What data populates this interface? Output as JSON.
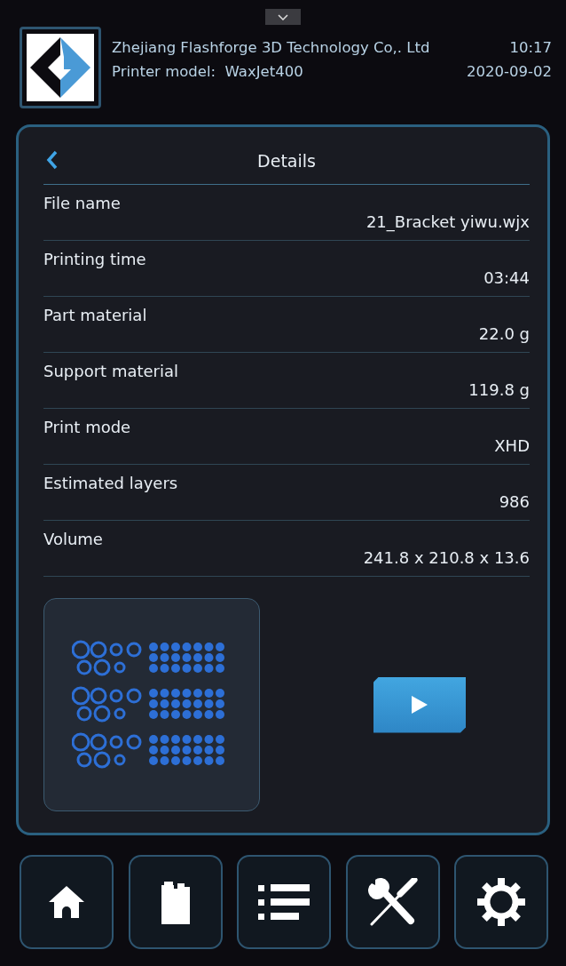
{
  "header": {
    "company": "Zhejiang Flashforge 3D Technology Co,. Ltd",
    "time": "10:17",
    "model_label": "Printer model:",
    "model": "WaxJet400",
    "date": "2020-09-02"
  },
  "details": {
    "title": "Details",
    "rows": [
      {
        "label": "File name",
        "value": "21_Bracket yiwu.wjx"
      },
      {
        "label": "Printing time",
        "value": "03:44"
      },
      {
        "label": "Part material",
        "value": "22.0 g"
      },
      {
        "label": "Support material",
        "value": "119.8 g"
      },
      {
        "label": "Print mode",
        "value": "XHD"
      },
      {
        "label": "Estimated layers",
        "value": "986"
      },
      {
        "label": "Volume",
        "value": "241.8 x 210.8 x 13.6"
      }
    ]
  },
  "nav": [
    {
      "kind": "home"
    },
    {
      "kind": "material"
    },
    {
      "kind": "list"
    },
    {
      "kind": "tools"
    },
    {
      "kind": "settings"
    }
  ]
}
